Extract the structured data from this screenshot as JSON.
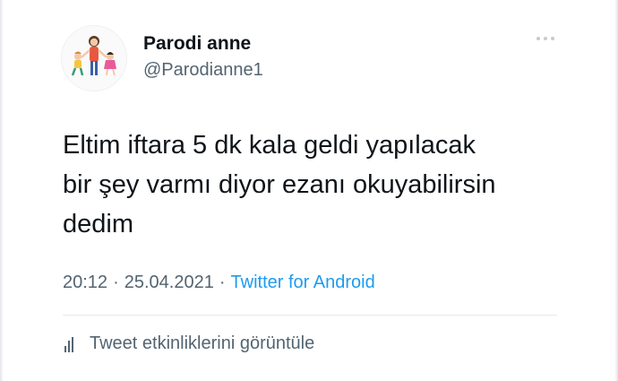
{
  "tweet": {
    "display_name": "Parodi anne",
    "handle": "@Parodianne1",
    "text_lines": [
      "Eltim iftara 5 dk kala geldi yapılacak",
      "bir şey varmı diyor ezanı okuyabilirsin",
      "dedim"
    ],
    "time": "20:12",
    "date": "25.04.2021",
    "separator": "·",
    "source": "Twitter for Android",
    "activity_label": "Tweet etkinliklerini görüntüle"
  },
  "icons": {
    "more": "more-horizontal-icon",
    "activity": "bar-chart-icon"
  },
  "colors": {
    "text_primary": "#0f1419",
    "text_secondary": "#536471",
    "link": "#1d9bf0",
    "divider": "#e6e9eb"
  }
}
